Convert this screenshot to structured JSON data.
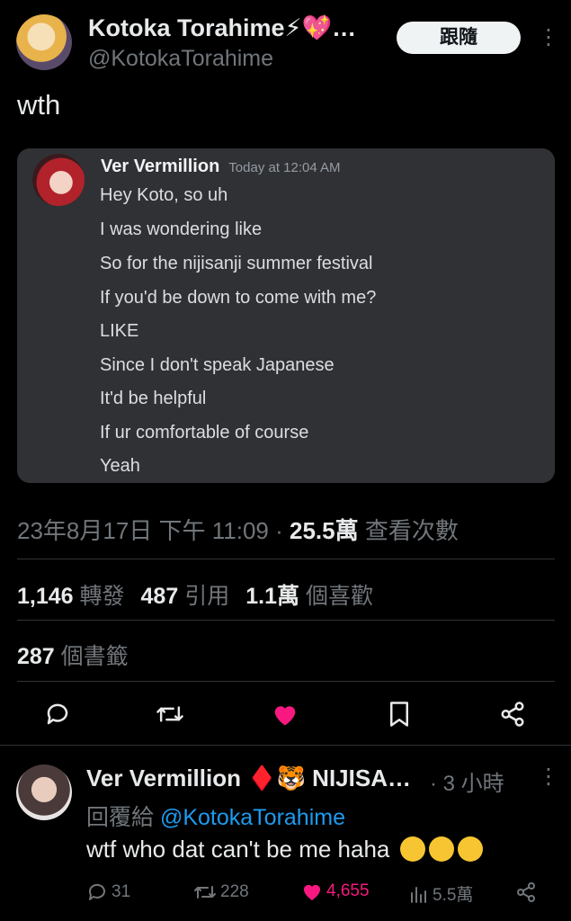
{
  "header": {
    "display_name": "Kotoka Torahime⚡💖…",
    "handle": "@KotokaTorahime",
    "follow_label": "跟隨",
    "more_label": "⋮"
  },
  "tweet": {
    "text": "wth",
    "embedded_message": {
      "author": "Ver Vermillion",
      "timestamp": "Today at 12:04 AM",
      "lines": [
        "Hey Koto, so uh",
        "I was wondering like",
        "So for the nijisanji summer festival",
        "If you'd be down to come with me?",
        "LIKE",
        "Since I don't speak Japanese",
        "It'd be helpful",
        "If ur comfortable of course",
        "Yeah"
      ]
    },
    "meta": {
      "datetime": "23年8月17日 下午 11:09 · ",
      "views_count": "25.5萬",
      "views_label": " 查看次數"
    },
    "stats": {
      "retweets_count": "1,146",
      "retweets_label": "轉發",
      "quotes_count": "487",
      "quotes_label": "引用",
      "likes_count": "1.1萬",
      "likes_label": "個喜歡",
      "bookmarks_count": "287",
      "bookmarks_label": "個書籤"
    }
  },
  "actions": [
    "reply-icon",
    "retweet-icon",
    "like-icon",
    "bookmark-icon",
    "share-icon"
  ],
  "reply": {
    "display_name": "Ver Vermillion ♦️🐯 NIJISA…",
    "time": "· 3 小時",
    "reply_prefix": "回覆給 ",
    "reply_mention": "@KotokaTorahime",
    "text": "wtf who dat can't be me haha",
    "more_label": "⋮",
    "stats": {
      "replies": "31",
      "retweets": "228",
      "likes": "4,655",
      "views": "5.5萬"
    }
  },
  "colors": {
    "background": "#000000",
    "text": "#e7e9ea",
    "muted": "#71767b",
    "like": "#f91880",
    "link": "#1d9bf0",
    "card": "#303134"
  }
}
